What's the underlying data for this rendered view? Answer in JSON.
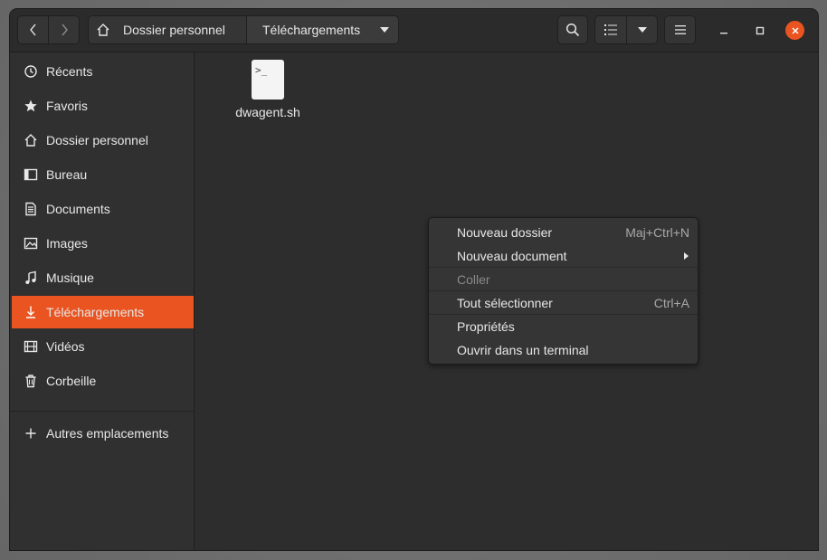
{
  "header": {
    "path": [
      {
        "label": "Dossier personnel",
        "icon": "home-icon"
      },
      {
        "label": "Téléchargements"
      }
    ]
  },
  "sidebar": {
    "items": [
      {
        "label": "Récents",
        "icon": "clock-icon",
        "active": false
      },
      {
        "label": "Favoris",
        "icon": "star-icon",
        "active": false
      },
      {
        "label": "Dossier personnel",
        "icon": "home-icon",
        "active": false
      },
      {
        "label": "Bureau",
        "icon": "desktop-icon",
        "active": false
      },
      {
        "label": "Documents",
        "icon": "document-icon",
        "active": false
      },
      {
        "label": "Images",
        "icon": "image-icon",
        "active": false
      },
      {
        "label": "Musique",
        "icon": "music-icon",
        "active": false
      },
      {
        "label": "Téléchargements",
        "icon": "download-icon",
        "active": true
      },
      {
        "label": "Vidéos",
        "icon": "video-icon",
        "active": false
      },
      {
        "label": "Corbeille",
        "icon": "trash-icon",
        "active": false
      }
    ],
    "other_locations": "Autres emplacements"
  },
  "files": [
    {
      "name": "dwagent.sh",
      "icon_text": ">_",
      "icon": "script-file-icon"
    }
  ],
  "context_menu": {
    "items": [
      {
        "label": "Nouveau dossier",
        "shortcut": "Maj+Ctrl+N"
      },
      {
        "label": "Nouveau document",
        "submenu": true
      },
      {
        "label": "Coller",
        "disabled": true
      },
      {
        "label": "Tout sélectionner",
        "shortcut": "Ctrl+A"
      },
      {
        "label": "Propriétés"
      },
      {
        "label": "Ouvrir dans un terminal"
      }
    ]
  },
  "colors": {
    "accent": "#e95420",
    "background": "#2d2d2d",
    "sidebar": "#303030",
    "text": "#e8e8e8"
  }
}
